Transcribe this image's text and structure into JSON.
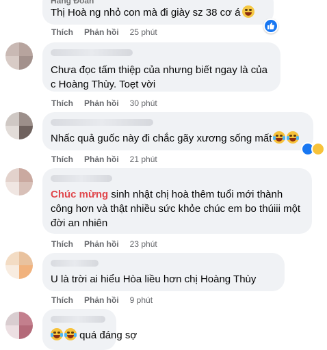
{
  "comments": [
    {
      "name_partial": "Hằng Đoàn",
      "text": "Thị Hoà ng nhỏ con mà đi giày sz 38 cơ á",
      "emoji": "flushed-smile-emoji",
      "like": "Thích",
      "reply": "Phản hồi",
      "time": "25 phút",
      "reaction": "like-reaction"
    },
    {
      "text": "Chưa đọc tấm thiệp của nhưng biết ngay là của c Hoàng Thùy. Toẹt vời",
      "like": "Thích",
      "reply": "Phản hồi",
      "time": "30 phút"
    },
    {
      "text": "Nhấc quả guốc này đi chắc gãy xương sống mất",
      "emoji": "laughing-tears-emoji",
      "like": "Thích",
      "reply": "Phản hồi",
      "time": "21 phút",
      "reaction": "like-haha-reaction"
    },
    {
      "highlight": "Chúc mừng",
      "text": " sinh nhật chị hoà thêm tuổi mới thành công hơn và thật nhiều sức khỏe chúc em bo thúiii một đời an nhiên",
      "like": "Thích",
      "reply": "Phản hồi",
      "time": "23 phút"
    },
    {
      "text": "U là trời ai hiểu Hòa liều hơn chị Hoàng Thùy",
      "like": "Thích",
      "reply": "Phản hồi",
      "time": "9 phút"
    },
    {
      "text": "quá đáng sợ",
      "emoji": "rofl-emoji"
    }
  ],
  "colors": {
    "bubble": "#f0f2f5",
    "meta": "#65676b",
    "highlight": "#e0474c",
    "like_blue": "#1877f2"
  }
}
